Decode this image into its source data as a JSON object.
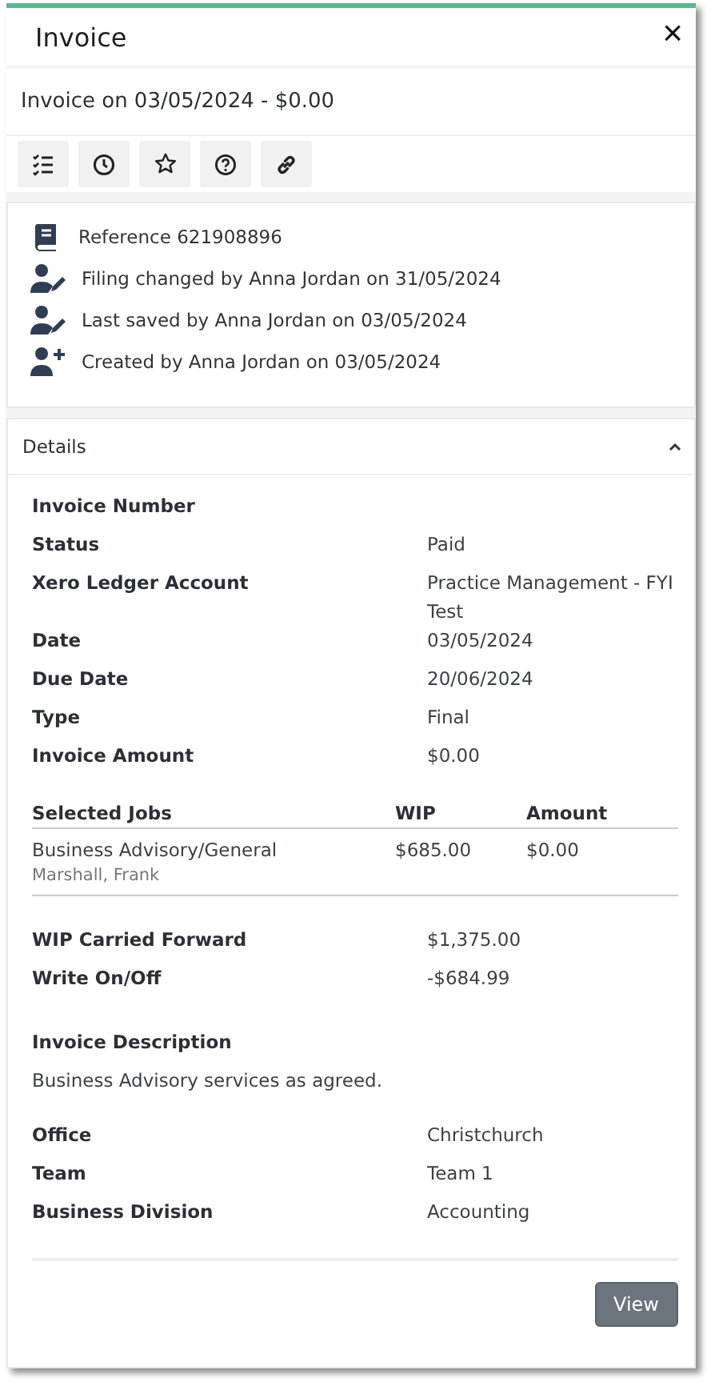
{
  "header": {
    "title": "Invoice",
    "close": "×"
  },
  "subtitle": "Invoice on 03/05/2024 - $0.00",
  "activity": [
    {
      "kind": "reference",
      "text": "Reference 621908896"
    },
    {
      "kind": "edit",
      "text": "Filing changed by Anna Jordan on 31/05/2024"
    },
    {
      "kind": "edit",
      "text": "Last saved by Anna Jordan on 03/05/2024"
    },
    {
      "kind": "create",
      "text": "Created by Anna Jordan on 03/05/2024"
    }
  ],
  "details": {
    "title": "Details",
    "expanded": true,
    "fields": [
      {
        "label": "Invoice Number"
      },
      {
        "label": "Status",
        "value": "Paid"
      },
      {
        "label": "Xero Ledger Account",
        "value": "Practice Management - FYI Test"
      },
      {
        "label": "Date",
        "value": "03/05/2024"
      },
      {
        "label": "Due Date",
        "value": "20/06/2024"
      },
      {
        "label": "Type",
        "value": "Final"
      },
      {
        "label": "Invoice Amount",
        "value": "$0.00"
      }
    ],
    "jobs": {
      "columns": [
        "Selected Jobs",
        "WIP",
        "Amount"
      ],
      "rows": [
        {
          "job": "Business Advisory/General",
          "client": "Marshall, Frank",
          "wip": "$685.00",
          "amount": "$0.00"
        }
      ]
    },
    "totals": [
      {
        "label": "WIP Carried Forward",
        "value": "$1,375.00"
      },
      {
        "label": "Write On/Off",
        "value": "-$684.99"
      }
    ],
    "description": {
      "label": "Invoice Description",
      "text": "Business Advisory services as agreed."
    },
    "org": [
      {
        "label": "Office",
        "value": "Christchurch"
      },
      {
        "label": "Team",
        "value": "Team 1"
      },
      {
        "label": "Business Division",
        "value": "Accounting"
      }
    ],
    "button": "View"
  }
}
